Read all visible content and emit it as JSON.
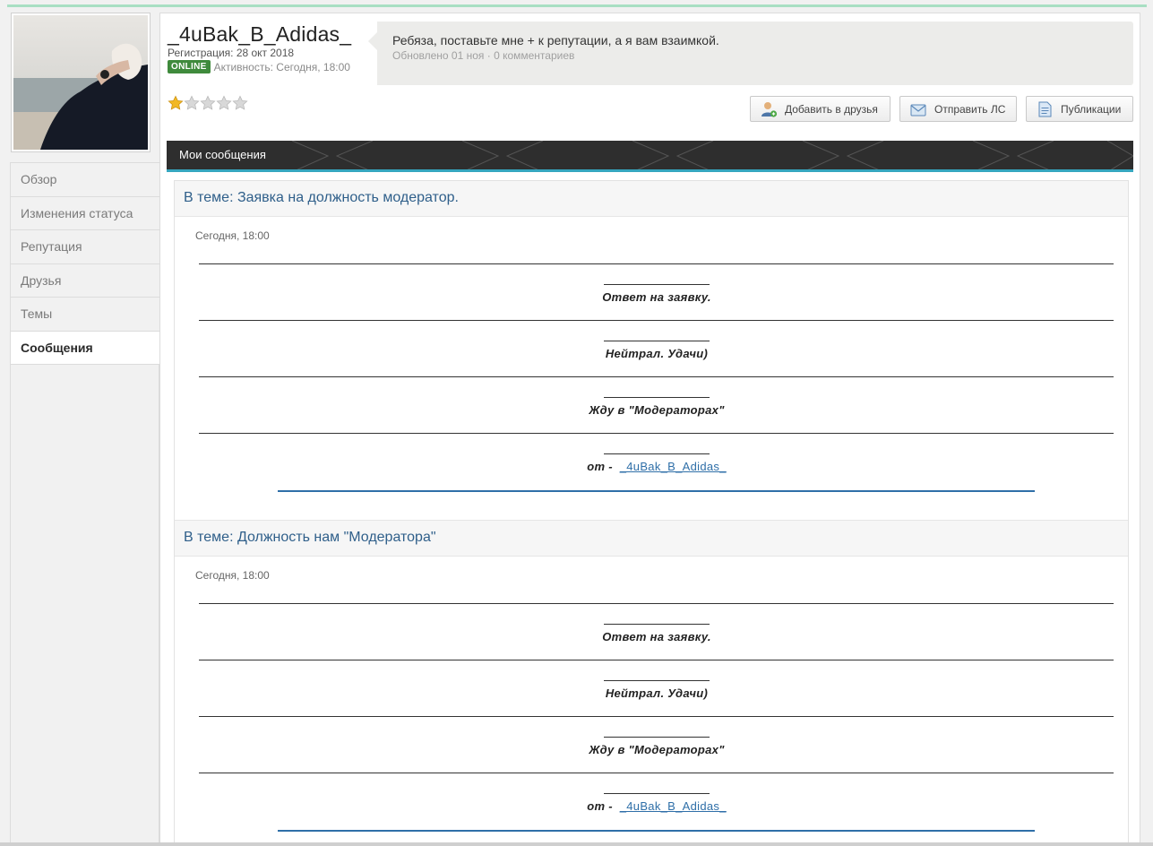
{
  "profile": {
    "username": "_4uBak_B_Adidas_",
    "registration": "Регистрация: 28 окт 2018",
    "online_badge": "ONLINE",
    "activity": "Активность: Сегодня, 18:00",
    "rating_stars": 1,
    "rating_max": 5
  },
  "status": {
    "text": "Ребяза, поставьте мне + к репутации, а я вам взаимкой.",
    "meta": "Обновлено 01 ноя · 0 комментариев"
  },
  "actions": {
    "add_friend": "Добавить в друзья",
    "send_pm": "Отправить ЛС",
    "publications": "Публикации"
  },
  "sidebar": {
    "items": [
      {
        "label": "Обзор"
      },
      {
        "label": "Изменения статуса"
      },
      {
        "label": "Репутация"
      },
      {
        "label": "Друзья"
      },
      {
        "label": "Темы"
      },
      {
        "label": "Сообщения"
      }
    ],
    "active": "Сообщения"
  },
  "section": {
    "title": "Мои сообщения"
  },
  "posts": [
    {
      "topic": "В теме: Заявка на должность модератор.",
      "date": "Сегодня, 18:00",
      "line1": "Ответ на заявку.",
      "line2": "Нейтрал. Удачи)",
      "line3": "Жду в \"Модераторах\"",
      "from_prefix": "от -",
      "from_link": "_4uBak_B_Adidas_"
    },
    {
      "topic": "В теме: Должность нам \"Модератора\"",
      "date": "Сегодня, 18:00",
      "line1": "Ответ на заявку.",
      "line2": "Нейтрал. Удачи)",
      "line3": "Жду в \"Модераторах\"",
      "from_prefix": "от -",
      "from_link": "_4uBak_B_Adidas_"
    }
  ],
  "colors": {
    "online": "#3f8a3c",
    "topic_link": "#2f5f8a",
    "section_bar": "#2e2e2e",
    "section_accent": "#36a6bf",
    "link": "#2f6fa8"
  }
}
